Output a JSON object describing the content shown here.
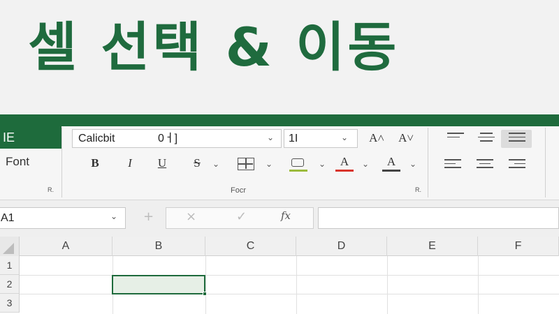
{
  "title": "셀 선택 & 이동",
  "ribbon": {
    "active_tab": "IE",
    "side_label": "Font",
    "font_group_label": "Focr",
    "launcher_left": "R.",
    "launcher_right": "R.",
    "font_name": "Calicbit",
    "font_name_extra": "0ㅓ]",
    "font_size": "1I",
    "grow_font": "A˄",
    "shrink_font": "A˅",
    "bold": "B",
    "italic": "I",
    "underline": "U",
    "strike": "S",
    "fill_color": "#9bbb3c",
    "font_color": "#d9342b",
    "font_color_letter": "A",
    "font_color2_letter": "A"
  },
  "formula_bar": {
    "name_box": "A1",
    "cancel_symbol": "×",
    "enter_symbol": "✓",
    "fx_symbol": "fx",
    "plus_symbol": "+"
  },
  "grid": {
    "columns": [
      "A",
      "B",
      "C",
      "D",
      "E",
      "F"
    ],
    "rows": [
      "1",
      "2",
      "3"
    ],
    "selected_cell": "B2"
  },
  "colors": {
    "accent": "#1e6b3c",
    "title": "#1f6b3e"
  }
}
